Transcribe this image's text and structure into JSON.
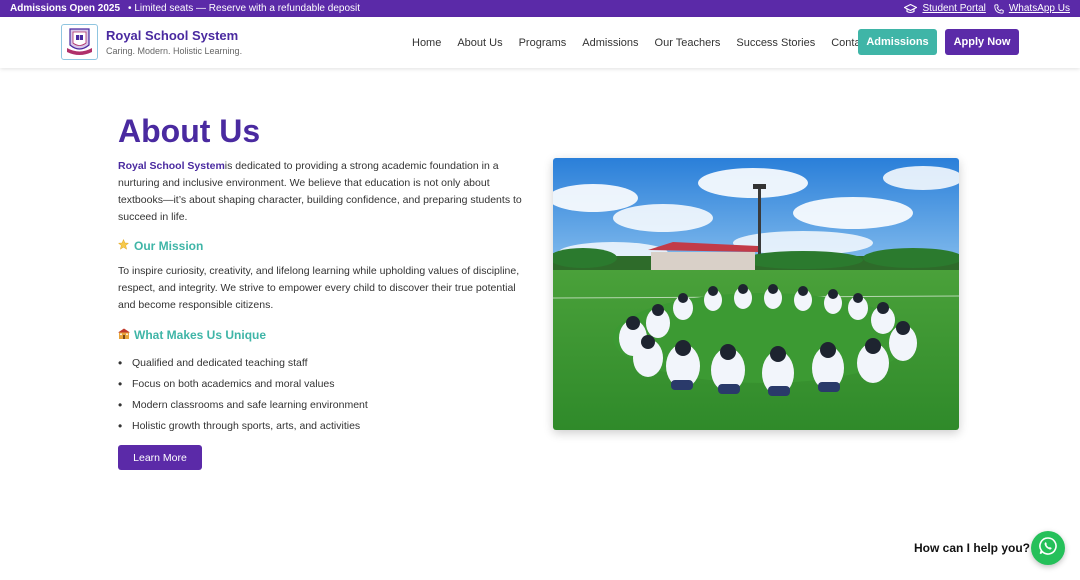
{
  "topbar": {
    "announcement_strong": "Admissions Open 2025",
    "announcement_text": "• Limited seats — Reserve with a refundable deposit",
    "links": [
      {
        "label": "Student Portal",
        "icon": "graduation-cap-icon"
      },
      {
        "label": "WhatsApp Us",
        "icon": "phone-icon"
      }
    ],
    "color": "#5b2aa8"
  },
  "header": {
    "brand_name": "Royal School System",
    "brand_tagline": "Caring. Modern. Holistic Learning.",
    "nav": [
      "Home",
      "About Us",
      "Programs",
      "Admissions",
      "Our Teachers",
      "Success Stories",
      "Contact"
    ],
    "admissions_button": "Admissions",
    "apply_button": "Apply Now"
  },
  "main": {
    "title": "About Us",
    "intro_highlight": "Royal School System",
    "intro_text": "is dedicated to providing a strong academic foundation in a nurturing and inclusive environment. We believe that education is not only about textbooks—it’s about shaping character, building confidence, and preparing students to succeed in life.",
    "mission_heading": "Our Mission",
    "mission_icon": "star-icon",
    "mission_text": "To inspire curiosity, creativity, and lifelong learning while upholding values of discipline, respect, and integrity. We strive to empower every child to discover their true potential and become responsible citizens.",
    "unique_heading": "What Makes Us Unique",
    "unique_icon": "school-icon",
    "unique_items": [
      "Qualified and dedicated teaching staff",
      "Focus on both academics and moral values",
      "Modern classrooms and safe learning environment",
      "Holistic growth through sports, arts, and activities"
    ],
    "learn_more_button": "Learn More"
  },
  "chat": {
    "prompt": "How can I help you?",
    "icon": "whatsapp-icon",
    "color": "#25c05a"
  },
  "colors": {
    "primary": "#5b2aa8",
    "accent": "#3fb5a7"
  }
}
